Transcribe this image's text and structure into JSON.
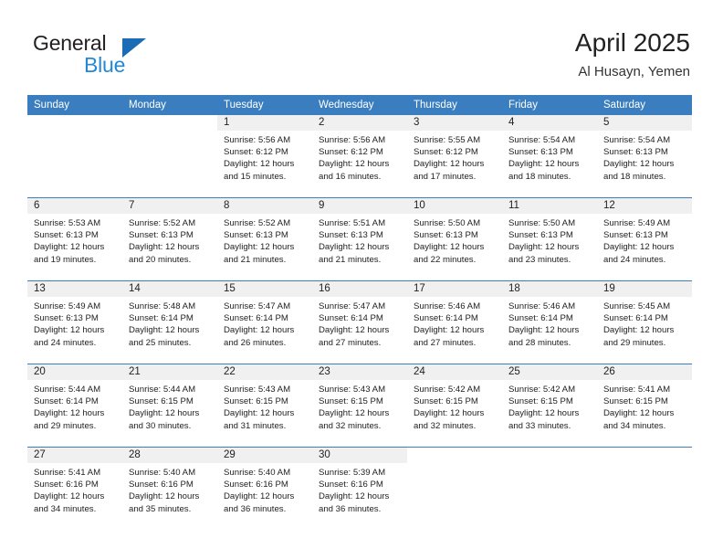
{
  "brand": {
    "name_top": "General",
    "name_bottom": "Blue",
    "triangle_color": "#1b6cb5",
    "blue_text_color": "#2388d6"
  },
  "header": {
    "title": "April 2025",
    "location": "Al Husayn, Yemen"
  },
  "theme": {
    "header_bg": "#3b7ebf",
    "header_text": "#ffffff",
    "daynum_band_bg": "#f0f0f0",
    "row_divider": "#3b7ebf",
    "body_text": "#222222"
  },
  "weekdays": [
    "Sunday",
    "Monday",
    "Tuesday",
    "Wednesday",
    "Thursday",
    "Friday",
    "Saturday"
  ],
  "calendar": {
    "weeks": [
      [
        {
          "day": "",
          "blank": true,
          "lines": []
        },
        {
          "day": "",
          "blank": true,
          "lines": []
        },
        {
          "day": "1",
          "lines": [
            "Sunrise: 5:56 AM",
            "Sunset: 6:12 PM",
            "Daylight: 12 hours",
            "and 15 minutes."
          ]
        },
        {
          "day": "2",
          "lines": [
            "Sunrise: 5:56 AM",
            "Sunset: 6:12 PM",
            "Daylight: 12 hours",
            "and 16 minutes."
          ]
        },
        {
          "day": "3",
          "lines": [
            "Sunrise: 5:55 AM",
            "Sunset: 6:12 PM",
            "Daylight: 12 hours",
            "and 17 minutes."
          ]
        },
        {
          "day": "4",
          "lines": [
            "Sunrise: 5:54 AM",
            "Sunset: 6:13 PM",
            "Daylight: 12 hours",
            "and 18 minutes."
          ]
        },
        {
          "day": "5",
          "lines": [
            "Sunrise: 5:54 AM",
            "Sunset: 6:13 PM",
            "Daylight: 12 hours",
            "and 18 minutes."
          ]
        }
      ],
      [
        {
          "day": "6",
          "lines": [
            "Sunrise: 5:53 AM",
            "Sunset: 6:13 PM",
            "Daylight: 12 hours",
            "and 19 minutes."
          ]
        },
        {
          "day": "7",
          "lines": [
            "Sunrise: 5:52 AM",
            "Sunset: 6:13 PM",
            "Daylight: 12 hours",
            "and 20 minutes."
          ]
        },
        {
          "day": "8",
          "lines": [
            "Sunrise: 5:52 AM",
            "Sunset: 6:13 PM",
            "Daylight: 12 hours",
            "and 21 minutes."
          ]
        },
        {
          "day": "9",
          "lines": [
            "Sunrise: 5:51 AM",
            "Sunset: 6:13 PM",
            "Daylight: 12 hours",
            "and 21 minutes."
          ]
        },
        {
          "day": "10",
          "lines": [
            "Sunrise: 5:50 AM",
            "Sunset: 6:13 PM",
            "Daylight: 12 hours",
            "and 22 minutes."
          ]
        },
        {
          "day": "11",
          "lines": [
            "Sunrise: 5:50 AM",
            "Sunset: 6:13 PM",
            "Daylight: 12 hours",
            "and 23 minutes."
          ]
        },
        {
          "day": "12",
          "lines": [
            "Sunrise: 5:49 AM",
            "Sunset: 6:13 PM",
            "Daylight: 12 hours",
            "and 24 minutes."
          ]
        }
      ],
      [
        {
          "day": "13",
          "lines": [
            "Sunrise: 5:49 AM",
            "Sunset: 6:13 PM",
            "Daylight: 12 hours",
            "and 24 minutes."
          ]
        },
        {
          "day": "14",
          "lines": [
            "Sunrise: 5:48 AM",
            "Sunset: 6:14 PM",
            "Daylight: 12 hours",
            "and 25 minutes."
          ]
        },
        {
          "day": "15",
          "lines": [
            "Sunrise: 5:47 AM",
            "Sunset: 6:14 PM",
            "Daylight: 12 hours",
            "and 26 minutes."
          ]
        },
        {
          "day": "16",
          "lines": [
            "Sunrise: 5:47 AM",
            "Sunset: 6:14 PM",
            "Daylight: 12 hours",
            "and 27 minutes."
          ]
        },
        {
          "day": "17",
          "lines": [
            "Sunrise: 5:46 AM",
            "Sunset: 6:14 PM",
            "Daylight: 12 hours",
            "and 27 minutes."
          ]
        },
        {
          "day": "18",
          "lines": [
            "Sunrise: 5:46 AM",
            "Sunset: 6:14 PM",
            "Daylight: 12 hours",
            "and 28 minutes."
          ]
        },
        {
          "day": "19",
          "lines": [
            "Sunrise: 5:45 AM",
            "Sunset: 6:14 PM",
            "Daylight: 12 hours",
            "and 29 minutes."
          ]
        }
      ],
      [
        {
          "day": "20",
          "lines": [
            "Sunrise: 5:44 AM",
            "Sunset: 6:14 PM",
            "Daylight: 12 hours",
            "and 29 minutes."
          ]
        },
        {
          "day": "21",
          "lines": [
            "Sunrise: 5:44 AM",
            "Sunset: 6:15 PM",
            "Daylight: 12 hours",
            "and 30 minutes."
          ]
        },
        {
          "day": "22",
          "lines": [
            "Sunrise: 5:43 AM",
            "Sunset: 6:15 PM",
            "Daylight: 12 hours",
            "and 31 minutes."
          ]
        },
        {
          "day": "23",
          "lines": [
            "Sunrise: 5:43 AM",
            "Sunset: 6:15 PM",
            "Daylight: 12 hours",
            "and 32 minutes."
          ]
        },
        {
          "day": "24",
          "lines": [
            "Sunrise: 5:42 AM",
            "Sunset: 6:15 PM",
            "Daylight: 12 hours",
            "and 32 minutes."
          ]
        },
        {
          "day": "25",
          "lines": [
            "Sunrise: 5:42 AM",
            "Sunset: 6:15 PM",
            "Daylight: 12 hours",
            "and 33 minutes."
          ]
        },
        {
          "day": "26",
          "lines": [
            "Sunrise: 5:41 AM",
            "Sunset: 6:15 PM",
            "Daylight: 12 hours",
            "and 34 minutes."
          ]
        }
      ],
      [
        {
          "day": "27",
          "lines": [
            "Sunrise: 5:41 AM",
            "Sunset: 6:16 PM",
            "Daylight: 12 hours",
            "and 34 minutes."
          ]
        },
        {
          "day": "28",
          "lines": [
            "Sunrise: 5:40 AM",
            "Sunset: 6:16 PM",
            "Daylight: 12 hours",
            "and 35 minutes."
          ]
        },
        {
          "day": "29",
          "lines": [
            "Sunrise: 5:40 AM",
            "Sunset: 6:16 PM",
            "Daylight: 12 hours",
            "and 36 minutes."
          ]
        },
        {
          "day": "30",
          "lines": [
            "Sunrise: 5:39 AM",
            "Sunset: 6:16 PM",
            "Daylight: 12 hours",
            "and 36 minutes."
          ]
        },
        {
          "day": "",
          "blank": true,
          "lines": []
        },
        {
          "day": "",
          "blank": true,
          "lines": []
        },
        {
          "day": "",
          "blank": true,
          "lines": []
        }
      ]
    ]
  }
}
